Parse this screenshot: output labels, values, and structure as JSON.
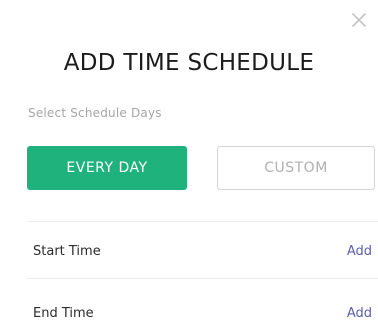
{
  "dialog": {
    "close_icon": "close-icon",
    "title": "ADD TIME SCHEDULE",
    "subtitle": "Select Schedule Days",
    "options": {
      "every_day": "EVERY DAY",
      "custom": "CUSTOM",
      "selected": "EVERY DAY"
    },
    "rows": [
      {
        "label": "Start Time",
        "action": "Add"
      },
      {
        "label": "End Time",
        "action": "Add"
      }
    ],
    "colors": {
      "accent": "#1fb27d",
      "link": "#5b5fa8"
    }
  }
}
